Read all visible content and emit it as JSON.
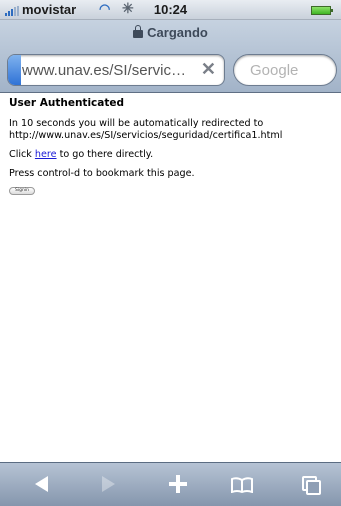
{
  "status_bar": {
    "carrier": "movistar",
    "time": "10:24",
    "icons": [
      "signal-icon",
      "wifi-icon",
      "activity-spinner-icon",
      "battery-icon"
    ]
  },
  "navbar": {
    "page_title": "Cargando",
    "url": "www.unav.es/SI/servic…",
    "search_placeholder": "Google",
    "load_progress_percent": 6
  },
  "page": {
    "heading": "User Authenticated",
    "redirect_line1": "In 10 seconds you will be automatically redirected to",
    "redirect_line2": "http://www.unav.es/SI/servicios/seguridad/certifica1.html",
    "click_prefix": "Click ",
    "click_link": "here",
    "click_suffix": " to go there directly.",
    "bookmark_text": "Press control-d to bookmark this page.",
    "signin_button": "Signin"
  },
  "toolbar": {
    "icons": [
      "back-icon",
      "forward-icon",
      "add-icon",
      "bookmarks-icon",
      "pages-icon"
    ]
  },
  "colors": {
    "link": "#1a1ad6",
    "progress": "#2f72d6",
    "toolbar": "#8596ad"
  }
}
